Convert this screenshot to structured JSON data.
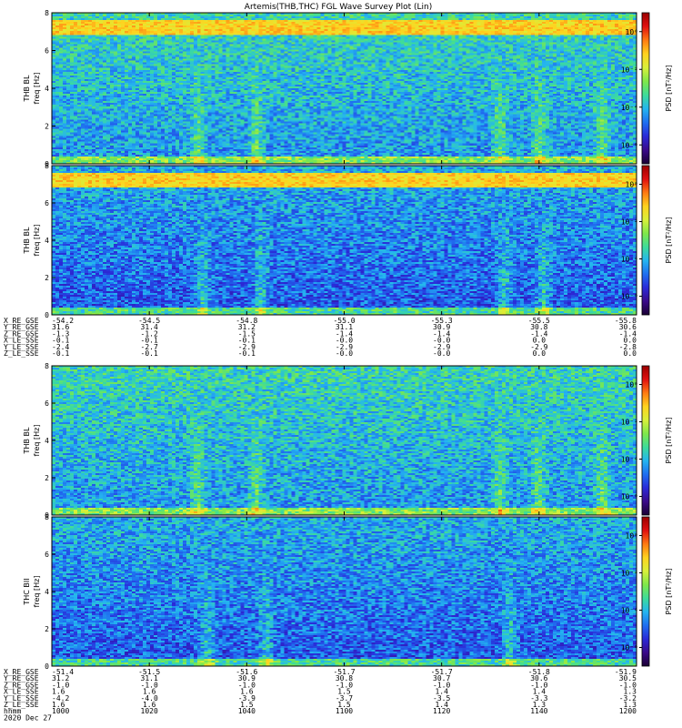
{
  "title": "Artemis(THB,THC) FGL Wave Survey Plot (Lin)",
  "colors": {
    "colormap": [
      "#1a0033",
      "#3a0a8a",
      "#2a2ad8",
      "#1f6ff0",
      "#24b5f0",
      "#3ddc9a",
      "#7fe84a",
      "#d8f03a",
      "#ffd21e",
      "#ff7a12",
      "#e01010",
      "#9a0000"
    ],
    "axis": "#000000",
    "background": "#ffffff"
  },
  "chart_data": [
    {
      "type": "heatmap",
      "name": "thb-bl-panel",
      "ylabel": "THB BL",
      "ylabel_units": "freq [Hz]",
      "ylim": [
        0,
        8
      ],
      "yticks": [
        0,
        2,
        4,
        6,
        8
      ],
      "colorbar_label": "PSD [nT²/Hz]",
      "colorbar_ticks": [
        "10⁰",
        "10⁻²",
        "10⁻⁴",
        "10⁻⁶"
      ],
      "z_log_range": [
        -7,
        1
      ],
      "noise_top_band_hz": [
        6.8,
        7.6
      ],
      "bursts_minute": [
        1030,
        1042,
        1132,
        1140,
        1153
      ]
    },
    {
      "type": "heatmap",
      "name": "thb-bl2-panel",
      "ylabel": "THB BL",
      "ylabel_units": "freq [Hz]",
      "ylim": [
        0,
        8
      ],
      "yticks": [
        0,
        2,
        4,
        6,
        8
      ],
      "colorbar_label": "PSD [nT²/Hz]",
      "colorbar_ticks": [
        "10⁰",
        "10⁻²",
        "10⁻⁴",
        "10⁻⁶"
      ],
      "z_log_range": [
        -7,
        1
      ],
      "noise_top_band_hz": [
        6.8,
        7.6
      ],
      "bursts_minute": [
        1031,
        1043,
        1133,
        1141
      ]
    },
    {
      "type": "heatmap",
      "name": "thb-bl-lower-panel",
      "ylabel": "THB BL",
      "ylabel_units": "freq [Hz]",
      "ylim": [
        0,
        8
      ],
      "yticks": [
        0,
        2,
        4,
        6,
        8
      ],
      "colorbar_label": "PSD [nT²/Hz]",
      "colorbar_ticks": [
        "10⁰",
        "10⁻²",
        "10⁻⁴",
        "10⁻⁶"
      ],
      "z_log_range": [
        -7,
        1
      ],
      "bursts_minute": [
        1030,
        1042,
        1132,
        1140,
        1153
      ]
    },
    {
      "type": "heatmap",
      "name": "thc-bll-panel",
      "ylabel": "THC BII",
      "ylabel_units": "freq [Hz]",
      "ylim": [
        0,
        8
      ],
      "yticks": [
        0,
        2,
        4,
        6,
        8
      ],
      "colorbar_label": "PSD [nT²/Hz]",
      "colorbar_ticks": [
        "10⁰",
        "10⁻²",
        "10⁻⁴",
        "10⁻⁶"
      ],
      "z_log_range": [
        -7,
        1
      ],
      "bursts_minute": [
        1032,
        1044,
        1134
      ]
    }
  ],
  "ephemeris_thb": {
    "labels": [
      "X_RE_GSE",
      "Y_RE_GSE",
      "Z_RE_GSE",
      "X_LE_SSE",
      "Y_LE_SSE",
      "Z_LE_SSE"
    ],
    "columns": [
      [
        "-54.2",
        "31.6",
        "-1.3",
        "-0.1",
        "-2.4",
        "-0.1"
      ],
      [
        "-54.5",
        "31.4",
        "-1.2",
        "-0.1",
        "-2.7",
        "-0.1"
      ],
      [
        "-54.8",
        "31.2",
        "-1.5",
        "-0.1",
        "-2.9",
        "-0.1"
      ],
      [
        "-55.0",
        "31.1",
        "-1.4",
        "-0.0",
        "-2.9",
        "-0.0"
      ],
      [
        "-55.3",
        "30.9",
        "-1.4",
        "-0.0",
        "-2.9",
        "-0.0"
      ],
      [
        "-55.5",
        "30.8",
        "-1.4",
        "0.0",
        "-2.9",
        "0.0"
      ],
      [
        "-55.8",
        "30.6",
        "-1.4",
        "0.0",
        "-2.8",
        "0.0"
      ]
    ]
  },
  "ephemeris_thc": {
    "labels": [
      "X_RE_GSE",
      "Y_RE_GSE",
      "Z_RE_GSE",
      "X_LE_SSE",
      "Y_LE_SSE",
      "Z_LE_SSE",
      "hhmm",
      "2020 Dec 27"
    ],
    "columns": [
      [
        "-51.4",
        "31.2",
        "-1.0",
        "1.6",
        "-4.2",
        "1.6",
        "1000",
        ""
      ],
      [
        "-51.5",
        "31.1",
        "-1.0",
        "1.6",
        "-4.0",
        "1.6",
        "1020",
        ""
      ],
      [
        "-51.6",
        "30.9",
        "-1.0",
        "1.6",
        "-3.9",
        "1.5",
        "1040",
        ""
      ],
      [
        "-51.7",
        "30.8",
        "-1.0",
        "1.5",
        "-3.7",
        "1.5",
        "1100",
        ""
      ],
      [
        "-51.7",
        "30.7",
        "-1.0",
        "1.4",
        "-3.5",
        "1.4",
        "1120",
        ""
      ],
      [
        "-51.8",
        "30.6",
        "-1.0",
        "1.4",
        "-3.3",
        "1.3",
        "1140",
        ""
      ],
      [
        "-51.9",
        "30.5",
        "-1.0",
        "1.3",
        "-3.2",
        "1.3",
        "1200",
        ""
      ]
    ]
  },
  "xaxis": {
    "ticks_hhmm": [
      "1000",
      "1020",
      "1040",
      "1100",
      "1120",
      "1140",
      "1200"
    ],
    "xlim_minutes": [
      600,
      720
    ]
  }
}
